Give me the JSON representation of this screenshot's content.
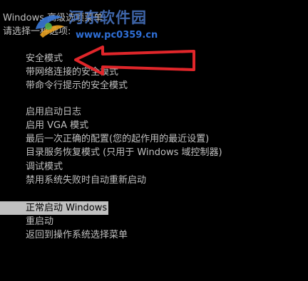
{
  "header": {
    "title": "Windows 高级选项菜单",
    "prompt": "请选择一种选项:"
  },
  "menu": {
    "items": [
      {
        "label": "安全模式"
      },
      {
        "label": "带网络连接的安全模式"
      },
      {
        "label": "带命令行提示的安全模式"
      },
      {
        "label": "启用启动日志"
      },
      {
        "label": "启用 VGA 模式"
      },
      {
        "label": "最后一次正确的配置(您的起作用的最近设置)"
      },
      {
        "label": "目录服务恢复模式 (只用于 Windows 域控制器)"
      },
      {
        "label": "调试模式"
      },
      {
        "label": "禁用系统失败时自动重新启动"
      },
      {
        "label": "正常启动 Windows",
        "selected": true
      },
      {
        "label": "重启动"
      },
      {
        "label": "返回到操作系统选择菜单"
      }
    ]
  },
  "watermark": {
    "name": "河东软件园",
    "url": "www.pc0359.cn"
  },
  "colors": {
    "background": "#000000",
    "text": "#c0c0c0",
    "highlight_bg": "#c0c0c0",
    "highlight_text": "#000000",
    "arrow": "#e0262a",
    "watermark_blue": "#2f6fd6"
  },
  "icons": {
    "annotation": "red-arrow-icon",
    "logo": "site-logo-icon"
  }
}
